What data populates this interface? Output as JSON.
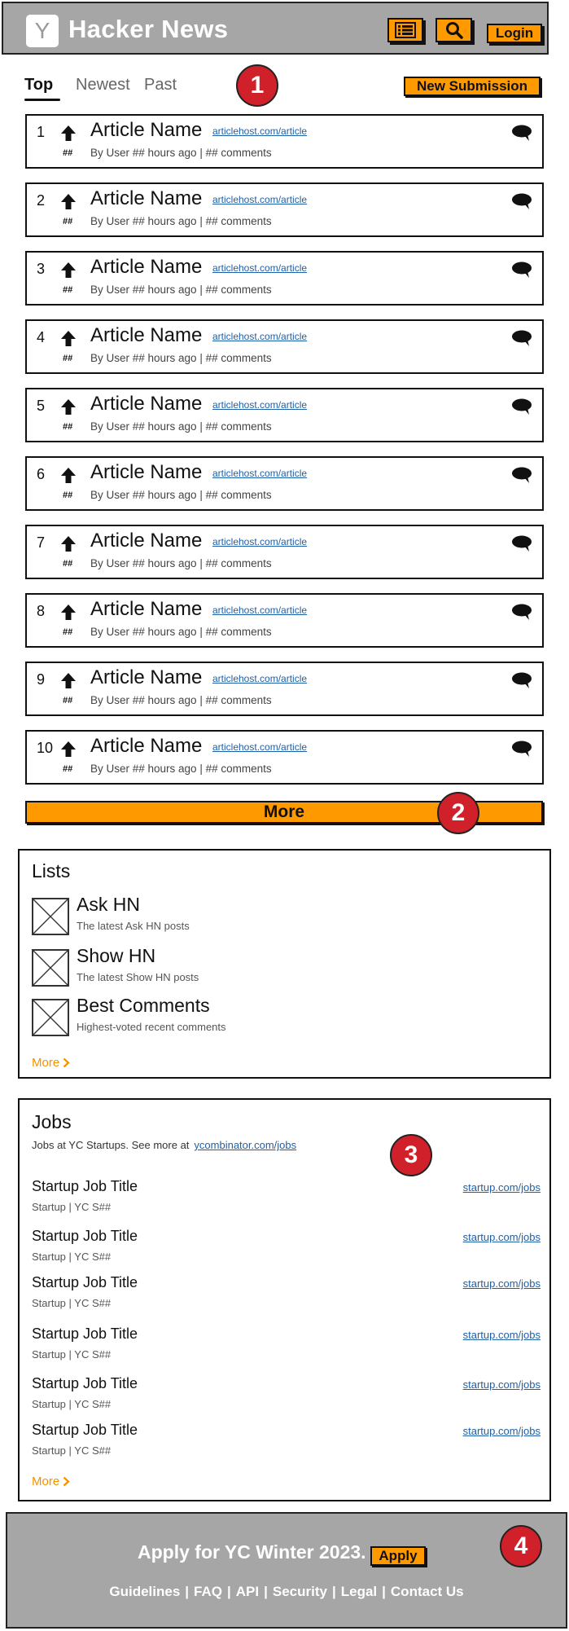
{
  "header": {
    "logo_letter": "Y",
    "title": "Hacker News",
    "login_label": "Login"
  },
  "tabs": [
    {
      "label": "Top",
      "active": true
    },
    {
      "label": "Newest",
      "active": false
    },
    {
      "label": "Past",
      "active": false
    }
  ],
  "new_submission_label": "New Submission",
  "markers": [
    "1",
    "2",
    "3",
    "4"
  ],
  "articles": [
    {
      "rank": "1",
      "title": "Article Name",
      "host": "articlehost.com/article",
      "score": "##",
      "meta": "By User ## hours ago | ## comments"
    },
    {
      "rank": "2",
      "title": "Article Name",
      "host": "articlehost.com/article",
      "score": "##",
      "meta": "By User ## hours ago | ## comments"
    },
    {
      "rank": "3",
      "title": "Article Name",
      "host": "articlehost.com/article",
      "score": "##",
      "meta": "By User ## hours ago | ## comments"
    },
    {
      "rank": "4",
      "title": "Article Name",
      "host": "articlehost.com/article",
      "score": "##",
      "meta": "By User ## hours ago | ## comments"
    },
    {
      "rank": "5",
      "title": "Article Name",
      "host": "articlehost.com/article",
      "score": "##",
      "meta": "By User ## hours ago | ## comments"
    },
    {
      "rank": "6",
      "title": "Article Name",
      "host": "articlehost.com/article",
      "score": "##",
      "meta": "By User ## hours ago | ## comments"
    },
    {
      "rank": "7",
      "title": "Article Name",
      "host": "articlehost.com/article",
      "score": "##",
      "meta": "By User ## hours ago | ## comments"
    },
    {
      "rank": "8",
      "title": "Article Name",
      "host": "articlehost.com/article",
      "score": "##",
      "meta": "By User ## hours ago | ## comments"
    },
    {
      "rank": "9",
      "title": "Article Name",
      "host": "articlehost.com/article",
      "score": "##",
      "meta": "By User ## hours ago | ## comments"
    },
    {
      "rank": "10",
      "title": "Article Name",
      "host": "articlehost.com/article",
      "score": "##",
      "meta": "By User ## hours ago | ## comments"
    }
  ],
  "more_label": "More",
  "lists": {
    "title": "Lists",
    "items": [
      {
        "name": "Ask HN",
        "desc": "The latest Ask HN posts"
      },
      {
        "name": "Show HN",
        "desc": "The latest Show HN posts"
      },
      {
        "name": "Best Comments",
        "desc": "Highest-voted recent comments"
      }
    ],
    "more_label": "More"
  },
  "jobs": {
    "title": "Jobs",
    "subtitle": "Jobs at YC Startups. See more at",
    "subtitle_link": "ycombinator.com/jobs",
    "items": [
      {
        "title": "Startup Job Title",
        "sub": "Startup | YC S##",
        "link": "startup.com/jobs"
      },
      {
        "title": "Startup Job Title",
        "sub": "Startup | YC S##",
        "link": "startup.com/jobs"
      },
      {
        "title": "Startup Job Title",
        "sub": "Startup | YC S##",
        "link": "startup.com/jobs"
      },
      {
        "title": "Startup Job Title",
        "sub": "Startup | YC S##",
        "link": "startup.com/jobs"
      },
      {
        "title": "Startup Job Title",
        "sub": "Startup | YC S##",
        "link": "startup.com/jobs"
      },
      {
        "title": "Startup Job Title",
        "sub": "Startup | YC S##",
        "link": "startup.com/jobs"
      }
    ],
    "more_label": "More"
  },
  "footer": {
    "apply_text": "Apply for YC Winter 2023.",
    "apply_label": "Apply",
    "links": [
      "Guidelines",
      "FAQ",
      "API",
      "Security",
      "Legal",
      "Contact Us"
    ]
  },
  "colors": {
    "accent": "#ff9900",
    "header_bg": "#a6a6a6",
    "marker": "#d0202a",
    "link": "#1f5fa8"
  }
}
